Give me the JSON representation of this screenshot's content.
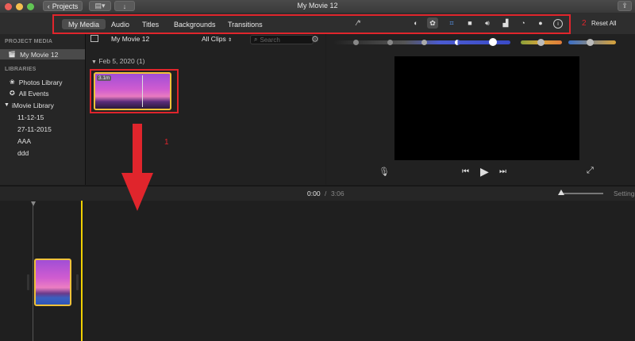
{
  "window": {
    "title": "My Movie 12",
    "projects_button": "Projects",
    "traffic_lights": [
      "#ec5f59",
      "#f4bf4f",
      "#61c554"
    ]
  },
  "toolbar": {
    "tabs": [
      {
        "label": "My Media",
        "active": true
      },
      {
        "label": "Audio",
        "active": false
      },
      {
        "label": "Titles",
        "active": false
      },
      {
        "label": "Backgrounds",
        "active": false
      },
      {
        "label": "Transitions",
        "active": false
      }
    ],
    "reset_all": "Reset All",
    "icons": [
      "magic-wand",
      "color-balance",
      "color-correction",
      "crop",
      "stabilization",
      "volume",
      "noise-reduction-equalizer",
      "speed",
      "clip-filter",
      "clip-info"
    ]
  },
  "annotations": {
    "label_1": "1",
    "label_2": "2",
    "color": "#e0252c"
  },
  "sidebar": {
    "project_media_header": "PROJECT MEDIA",
    "project_item": "My Movie 12",
    "libraries_header": "LIBRARIES",
    "items": [
      {
        "label": "Photos Library",
        "icon": "photos-icon"
      },
      {
        "label": "All Events",
        "icon": "star-icon"
      },
      {
        "label": "iMovie Library",
        "icon": "disclosure-icon"
      },
      {
        "label": "11-12-15"
      },
      {
        "label": "27-11-2015"
      },
      {
        "label": "AAA"
      },
      {
        "label": "ddd"
      }
    ]
  },
  "browser": {
    "title": "My Movie 12",
    "filter": "All Clips",
    "search_placeholder": "Search",
    "date_group": "Feb 5, 2020",
    "group_count": "(1)",
    "clip_duration": "3.1m"
  },
  "timeline": {
    "current_time": "0:00",
    "separator": "/",
    "total_time": "3:06",
    "settings": "Settings"
  },
  "colors": {
    "accent": "#f0c23a",
    "slider_blue": "#4b5bd1",
    "slider_orange": "#d8a23a",
    "slider_green": "#8aa13a"
  }
}
